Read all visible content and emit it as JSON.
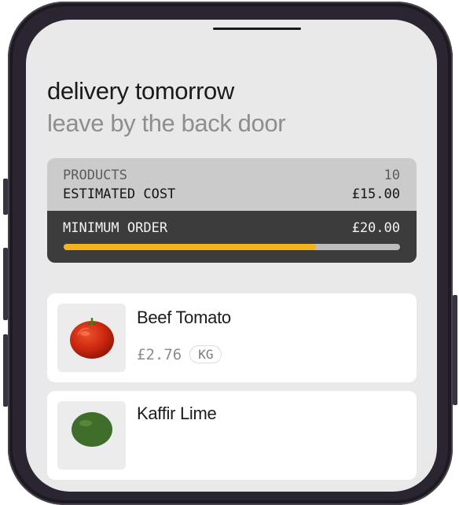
{
  "header": {
    "title": "delivery tomorrow",
    "subtitle": "leave by the back door"
  },
  "summary": {
    "products_label": "PRODUCTS",
    "products_count": "10",
    "estimated_cost_label": "ESTIMATED COST",
    "estimated_cost_value": "£15.00",
    "minimum_order_label": "MINIMUM ORDER",
    "minimum_order_value": "£20.00",
    "progress_fraction": 0.75,
    "progress_color": "#f6b21a"
  },
  "products": [
    {
      "name": "Beef Tomato",
      "price": "£2.76",
      "unit": "KG",
      "icon": "tomato-image"
    },
    {
      "name": "Kaffir Lime",
      "icon": "lime-image"
    }
  ]
}
